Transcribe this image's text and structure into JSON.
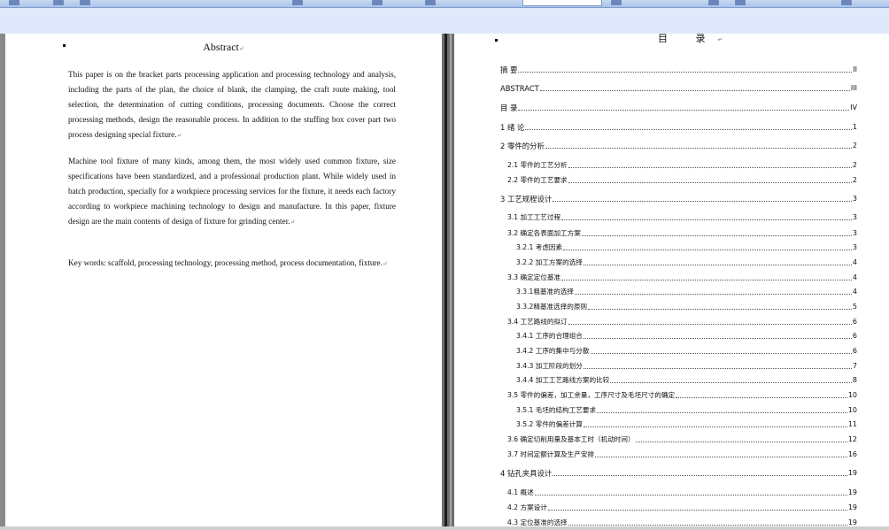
{
  "left_page": {
    "title": "Abstract",
    "paragraphs": [
      "This paper is on the bracket parts processing application and processing technology and analysis, including the parts of the plan, the choice of blank, the clamping, the craft route making, tool selection, the determination of cutting conditions, processing documents. Choose the correct processing methods, design the reasonable process. In addition to the stuffing box cover part two process designing special fixture.",
      "Machine tool fixture of many kinds, among them, the most widely used common fixture, size specifications have been standardized, and a professional production plant. While widely used in batch production, specially for a workpiece processing services for the fixture, it needs each factory according to workpiece machining technology to design and manufacture. In this paper, fixture design are the main contents of design of fixture for grinding center.",
      "Key words: scaffold, processing technology, processing method, process documentation, fixture."
    ],
    "paragraph_mark": "↵"
  },
  "right_page": {
    "title": "目  录",
    "toc": [
      {
        "text": "摘    要",
        "page": "II",
        "level": 1
      },
      {
        "text": "ABSTRACT",
        "page": "III",
        "level": 1
      },
      {
        "text": "目    录",
        "page": "IV",
        "level": 1
      },
      {
        "text": "1  绪  论",
        "page": "1",
        "level": 1
      },
      {
        "text": "2  零件的分析",
        "page": "2",
        "level": 1
      },
      {
        "text": "2.1 零件的工艺分析",
        "page": "2",
        "level": 2
      },
      {
        "text": "2.2 零件的工艺要求",
        "page": "2",
        "level": 2
      },
      {
        "text": "3   工艺规程设计",
        "page": "3",
        "level": 1
      },
      {
        "text": "3.1 加工工艺过程",
        "page": "3",
        "level": 2
      },
      {
        "text": "3.2 确定各表面加工方案",
        "page": "3",
        "level": 2
      },
      {
        "text": "3.2.1  考虑因素",
        "page": "3",
        "level": 3
      },
      {
        "text": "3.2.2  加工方案的选择",
        "page": "4",
        "level": 3
      },
      {
        "text": "3.3 确定定位基准",
        "page": "4",
        "level": 2
      },
      {
        "text": "3.3.1粗基准的选择",
        "page": "4",
        "level": 3
      },
      {
        "text": "3.3.2精基准选择的原则",
        "page": "5",
        "level": 3
      },
      {
        "text": "3.4 工艺路线的拟订",
        "page": "6",
        "level": 2
      },
      {
        "text": "3.4.1 工序的合理组合",
        "page": "6",
        "level": 3
      },
      {
        "text": "3.4.2 工序的集中与分散",
        "page": "6",
        "level": 3
      },
      {
        "text": "3.4.3 加工阶段的划分",
        "page": "7",
        "level": 3
      },
      {
        "text": "3.4.4 加工工艺路线方案的比较",
        "page": "8",
        "level": 3
      },
      {
        "text": "3.5 零件的偏差，加工余量，工序尺寸及毛坯尺寸的确定",
        "page": "10",
        "level": 2
      },
      {
        "text": "3.5.1 毛坯的结构工艺要求",
        "page": "10",
        "level": 3
      },
      {
        "text": "3.5.2 零件的偏差计算",
        "page": "11",
        "level": 3
      },
      {
        "text": "3.6 确定切削用量及基本工时（机动时间）",
        "page": "12",
        "level": 2
      },
      {
        "text": "3.7 时间定额计算及生产安排",
        "page": "16",
        "level": 2
      },
      {
        "text": "4  钻孔夹具设计",
        "page": "19",
        "level": 1
      },
      {
        "text": "4.1 概述",
        "page": "19",
        "level": 2
      },
      {
        "text": "4.2 方案设计",
        "page": "19",
        "level": 2
      },
      {
        "text": "4.3 定位基准的选择",
        "page": "19",
        "level": 2
      }
    ]
  }
}
